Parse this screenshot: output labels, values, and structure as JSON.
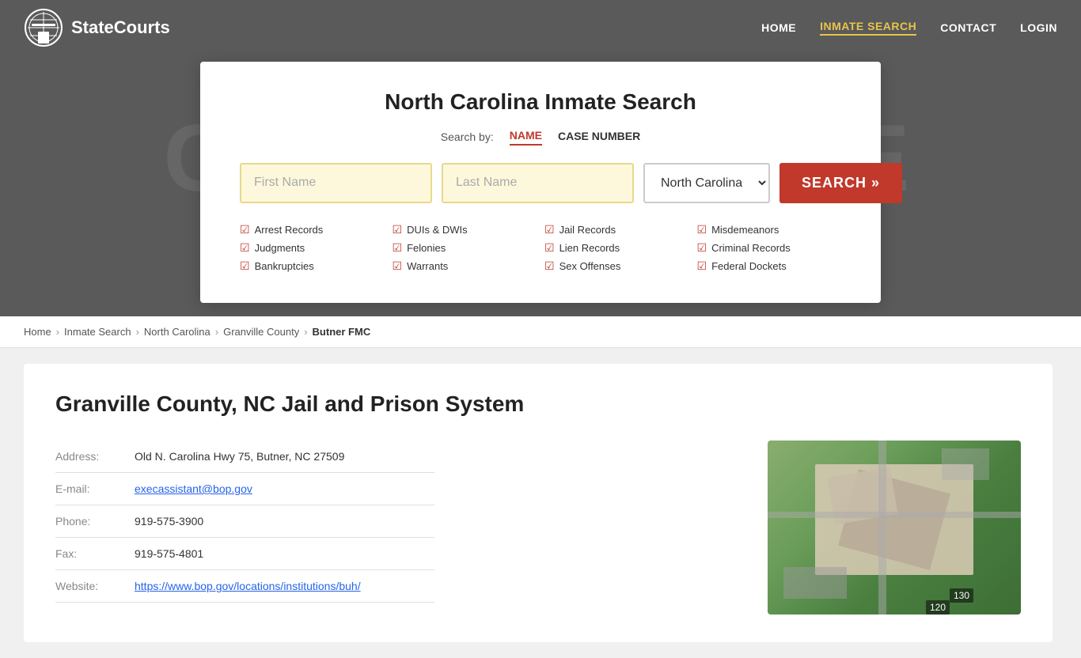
{
  "site": {
    "name": "StateCourts"
  },
  "nav": {
    "home_label": "HOME",
    "inmate_search_label": "INMATE SEARCH",
    "contact_label": "CONTACT",
    "login_label": "LOGIN"
  },
  "hero": {
    "bg_text": "COURTHOUSE"
  },
  "search_card": {
    "title": "North Carolina Inmate Search",
    "search_by_label": "Search by:",
    "tab_name": "NAME",
    "tab_case": "CASE NUMBER",
    "first_name_placeholder": "First Name",
    "last_name_placeholder": "Last Name",
    "state_value": "North Carolina",
    "search_button": "SEARCH »",
    "checklist": [
      {
        "col": 0,
        "label": "Arrest Records"
      },
      {
        "col": 0,
        "label": "Judgments"
      },
      {
        "col": 0,
        "label": "Bankruptcies"
      },
      {
        "col": 1,
        "label": "DUIs & DWIs"
      },
      {
        "col": 1,
        "label": "Felonies"
      },
      {
        "col": 1,
        "label": "Warrants"
      },
      {
        "col": 2,
        "label": "Jail Records"
      },
      {
        "col": 2,
        "label": "Lien Records"
      },
      {
        "col": 2,
        "label": "Sex Offenses"
      },
      {
        "col": 3,
        "label": "Misdemeanors"
      },
      {
        "col": 3,
        "label": "Criminal Records"
      },
      {
        "col": 3,
        "label": "Federal Dockets"
      }
    ]
  },
  "breadcrumb": {
    "items": [
      {
        "label": "Home",
        "href": "#"
      },
      {
        "label": "Inmate Search",
        "href": "#"
      },
      {
        "label": "North Carolina",
        "href": "#"
      },
      {
        "label": "Granville County",
        "href": "#"
      },
      {
        "label": "Butner FMC",
        "href": "#",
        "current": true
      }
    ]
  },
  "facility": {
    "title": "Granville County, NC Jail and Prison System",
    "address_label": "Address:",
    "address_value": "Old N. Carolina Hwy 75, Butner, NC 27509",
    "email_label": "E-mail:",
    "email_value": "execassistant@bop.gov",
    "phone_label": "Phone:",
    "phone_value": "919-575-3900",
    "fax_label": "Fax:",
    "fax_value": "919-575-4801",
    "website_label": "Website:",
    "website_value": "https://www.bop.gov/locations/institutions/buh/",
    "img_label_130": "130",
    "img_label_120": "120"
  }
}
